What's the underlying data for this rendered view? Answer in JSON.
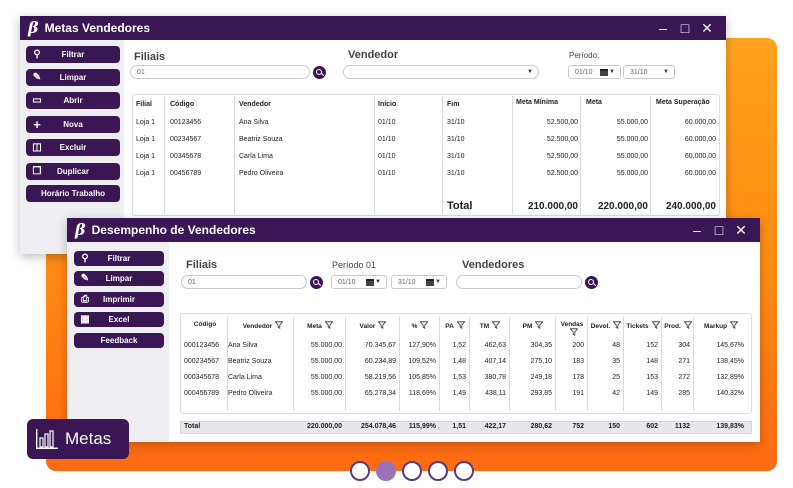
{
  "win1": {
    "title": "Metas Vendedores",
    "sidebar": [
      "Filtrar",
      "Limpar",
      "Abrir",
      "Nova",
      "Excluir",
      "Duplicar",
      "Horário Trabalho"
    ],
    "filters": {
      "filiais_label": "Filiais",
      "filiais_value": "01",
      "vendedor_label": "Vendedor",
      "vendedor_value": "",
      "periodo_label": "Período:",
      "periodo_start": "01/10",
      "periodo_end": "31/10"
    },
    "table": {
      "headers": [
        "Filial",
        "Código",
        "Vendedor",
        "Início",
        "Fim",
        "Meta Mínima",
        "Meta",
        "Meta Superação"
      ],
      "rows": [
        [
          "Loja 1",
          "00123456",
          "Ana Silva",
          "01/10",
          "31/10",
          "52.500,00",
          "55.000,00",
          "60.000,00"
        ],
        [
          "Loja 1",
          "00234567",
          "Beatriz Souza",
          "01/10",
          "31/10",
          "52.500,00",
          "55.000,00",
          "60.000,00"
        ],
        [
          "Loja 1",
          "00345678",
          "Carla Lima",
          "01/10",
          "31/10",
          "52.500,00",
          "55.000,00",
          "60.000,00"
        ],
        [
          "Loja 1",
          "00456789",
          "Pedro Oliveira",
          "01/10",
          "31/10",
          "52.500,00",
          "55.000,00",
          "60.000,00"
        ]
      ],
      "total_label": "Total",
      "totals": [
        "210.000,00",
        "220.000,00",
        "240.000,00"
      ]
    }
  },
  "win2": {
    "title": "Desempenho de Vendedores",
    "sidebar": [
      "Filtrar",
      "Limpar",
      "Imprimir",
      "Excel",
      "Feedback"
    ],
    "filters": {
      "filiais_label": "Filiais",
      "filiais_value": "01",
      "periodo_label": "Período 01",
      "periodo_start": "01/10",
      "periodo_end": "31/10",
      "vendedores_label": "Vendedores",
      "vendedores_value": ""
    },
    "table": {
      "headers": [
        "Código",
        "Vendedor",
        "Meta",
        "Valor",
        "%",
        "PA",
        "TM",
        "PM",
        "Vendas",
        "Devol.",
        "Tickets",
        "Prod.",
        "Markup"
      ],
      "rows": [
        [
          "000123456",
          "Ana Silva",
          "55.000,00",
          "70.345,67",
          "127,90%",
          "1,52",
          "462,63",
          "304,35",
          "200",
          "48",
          "152",
          "304",
          "145,67%"
        ],
        [
          "000234567",
          "Beatriz Souza",
          "55.000,00",
          "60.234,89",
          "109,52%",
          "1,48",
          "407,14",
          "275,10",
          "183",
          "35",
          "148",
          "271",
          "138,45%"
        ],
        [
          "000345678",
          "Carla Lima",
          "55.000,00",
          "58.219,56",
          "105,85%",
          "1,53",
          "380,78",
          "249,18",
          "178",
          "25",
          "153",
          "272",
          "132,89%"
        ],
        [
          "000456789",
          "Pedro Oliveira",
          "55.000,00",
          "65.278,34",
          "118,69%",
          "1,49",
          "438,11",
          "293,85",
          "191",
          "42",
          "149",
          "285",
          "140,32%"
        ]
      ],
      "total_label": "Total",
      "totals": [
        "220.000,00",
        "254.078,46",
        "115,99%",
        "1,51",
        "422,17",
        "280,62",
        "752",
        "150",
        "602",
        "1132",
        "139,83%"
      ]
    }
  },
  "badge": {
    "label": "Metas",
    "icon": "bar-chart-icon"
  },
  "carousel": {
    "count": 5,
    "active_index": 1
  },
  "colors": {
    "primary": "#3a1654",
    "accent": "#ff8a12",
    "dot_active": "#9b72b8"
  }
}
